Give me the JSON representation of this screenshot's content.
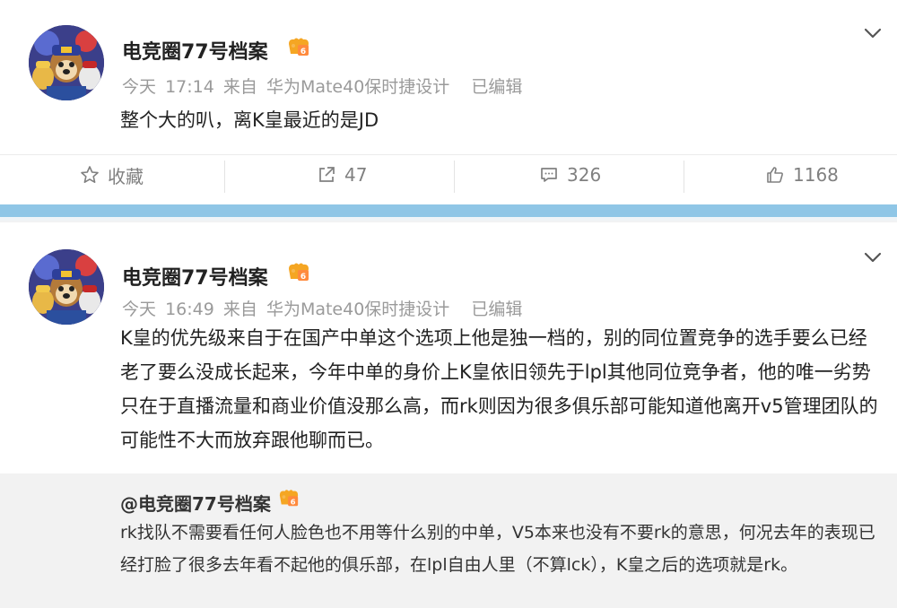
{
  "posts": [
    {
      "author": "电竞圈77号档案",
      "meta": {
        "day": "今天",
        "time": "17:14",
        "source_prefix": "来自",
        "device": "华为Mate40保时捷设计",
        "edited": "已编辑"
      },
      "text": "整个大的叭，离K皇最近的是JD",
      "actions": {
        "favorite": "收藏",
        "share": "47",
        "comment": "326",
        "like": "1168"
      }
    },
    {
      "author": "电竞圈77号档案",
      "meta": {
        "day": "今天",
        "time": "16:49",
        "source_prefix": "来自",
        "device": "华为Mate40保时捷设计",
        "edited": "已编辑"
      },
      "text": "K皇的优先级来自于在国产中单这个选项上他是独一档的，别的同位置竞争的选手要么已经老了要么没成长起来，今年中单的身价上K皇依旧领先于lpl其他同位竞争者，他的唯一劣势只在于直播流量和商业价值没那么高，而rk则因为很多俱乐部可能知道他离开v5管理团队的可能性不大而放弃跟他聊而已。",
      "quote": {
        "user": "@电竞圈77号档案",
        "text": "rk找队不需要看任何人脸色也不用等什么别的中单，V5本来也没有不要rk的意思，何况去年的表现已经打脸了很多去年看不起他的俱乐部，在lpl自由人里（不算lck），K皇之后的选项就是rk。"
      }
    }
  ],
  "icons": {
    "favorite": "star-icon",
    "share": "share-icon",
    "comment": "comment-icon",
    "like": "thumbs-up-icon",
    "more": "chevron-down-icon",
    "badge": "vip-badge-icon"
  },
  "colors": {
    "separator": "#8fc6e6",
    "quote_bg": "#f2f2f2",
    "meta": "#9a9a9a",
    "badge": "#f5a623"
  }
}
